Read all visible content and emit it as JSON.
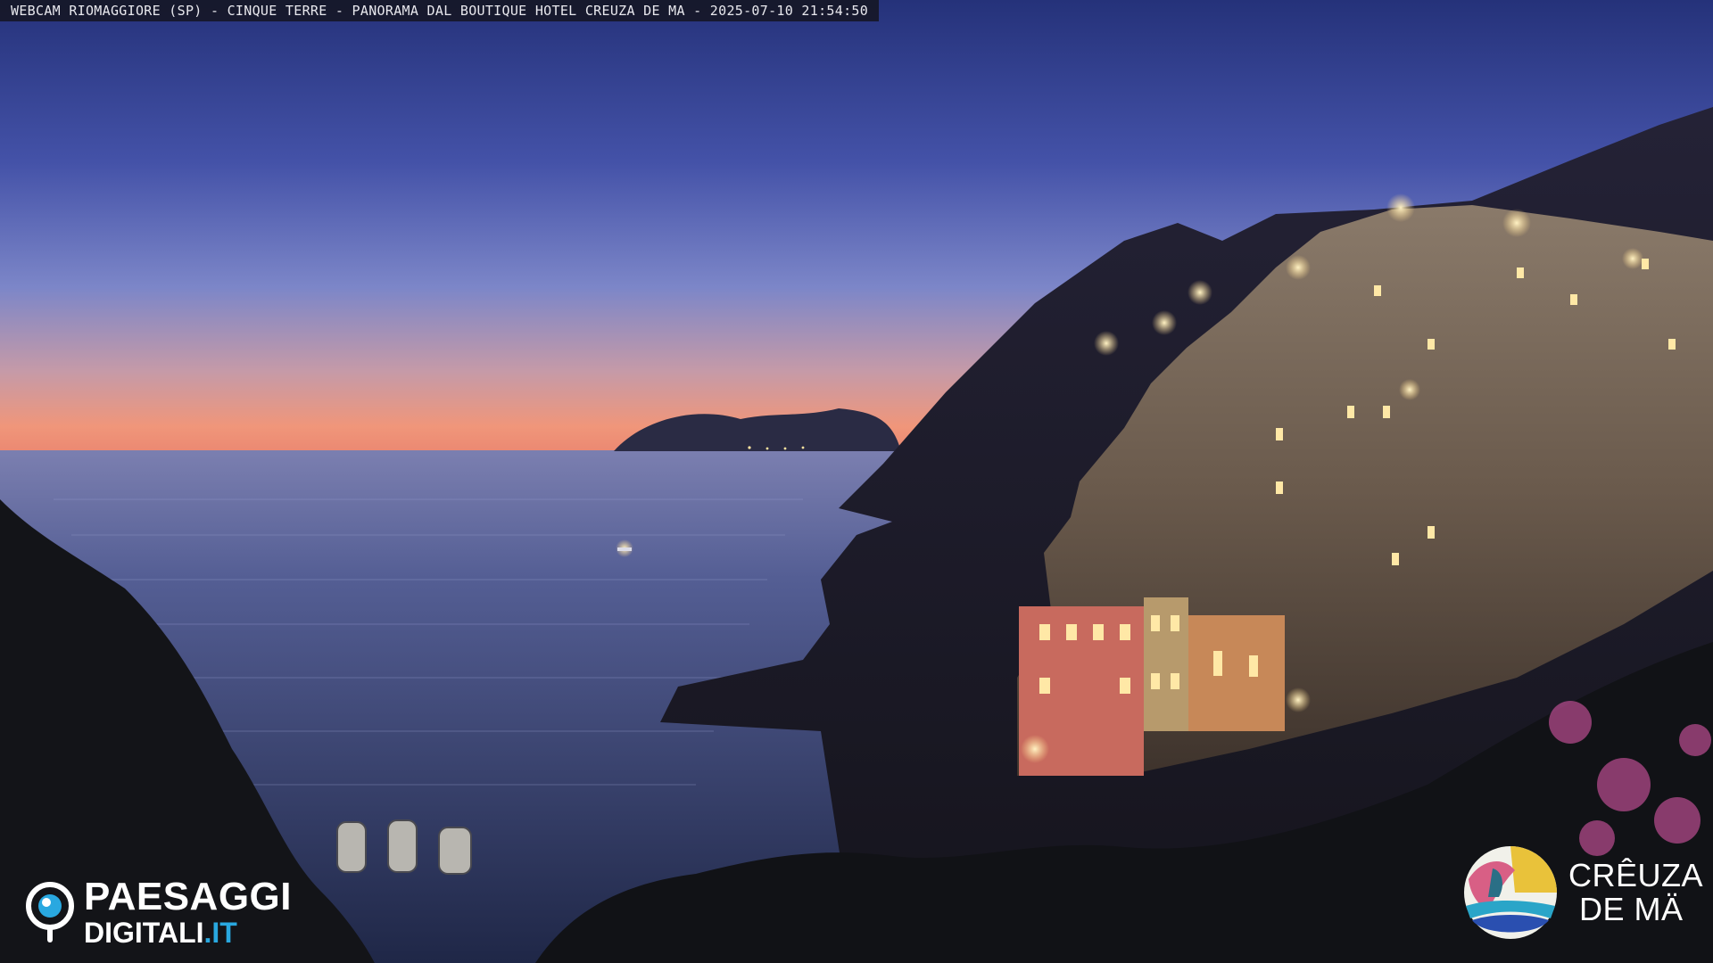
{
  "overlay": {
    "caption": "WEBCAM RIOMAGGIORE (SP) - CINQUE TERRE - PANORAMA DAL BOUTIQUE HOTEL CREUZA DE MA - 2025-07-10 21:54:50"
  },
  "logos": {
    "left": {
      "line1": "PAESAGGI",
      "line2_main": "DIGITALI",
      "line2_tld": ".IT",
      "icon": "webcam-pin-icon"
    },
    "right": {
      "line1": "CRÊUZA",
      "line2": "DE MÄ",
      "icon": "creuza-de-ma-emblem-icon"
    }
  },
  "colors": {
    "sky_top": "#2a3a8c",
    "sky_mid": "#5a6cc0",
    "horizon_glow": "#f0967a",
    "sea": "#3a4778",
    "village_light": "#ffd98a",
    "paesaggi_accent": "#29a8e0"
  }
}
